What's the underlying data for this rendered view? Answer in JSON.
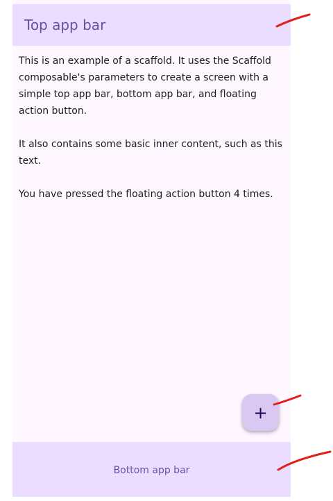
{
  "top_app_bar": {
    "title": "Top app bar"
  },
  "content": {
    "paragraphs": [
      "This is an example of a scaffold. It uses the Scaffold composable's parameters to create a screen with a simple top app bar, bottom app bar, and floating action button.",
      "It also contains some basic inner content, such as this text.",
      "You have pressed the floating action button 4 times."
    ]
  },
  "fab": {
    "icon": "+",
    "icon_name": "add-icon"
  },
  "bottom_app_bar": {
    "text": "Bottom app bar"
  },
  "colors": {
    "bar_background": "#eaddff",
    "bar_text": "#6750a4",
    "surface": "#fef7ff",
    "fab_background": "#d9c9f2",
    "annotation_stroke": "#e0201a"
  }
}
